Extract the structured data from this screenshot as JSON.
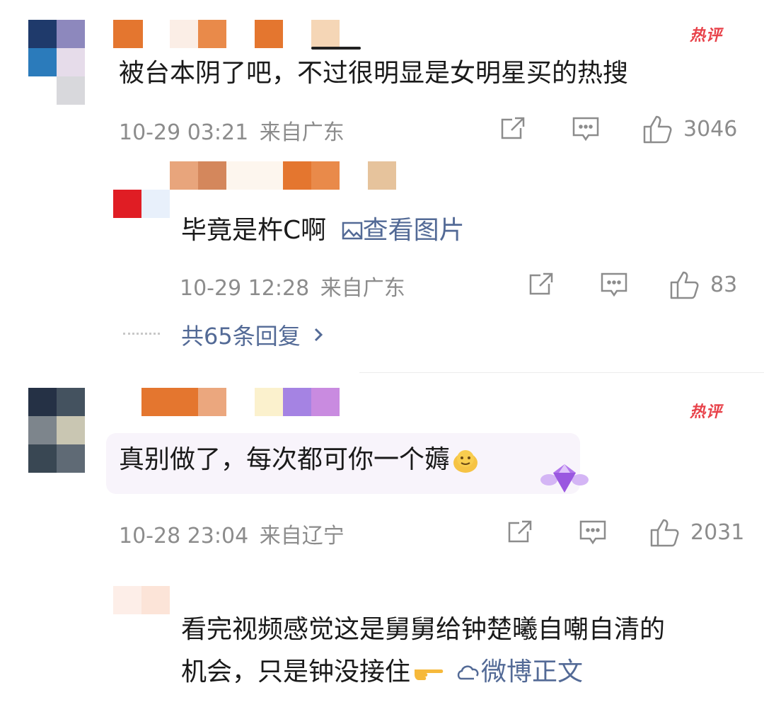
{
  "comments": [
    {
      "hot_badge": "热评",
      "text": "被台本阴了吧，不过很明显是女明星买的热搜",
      "time": "10-29 03:21",
      "location": "来自广东",
      "likes": "3046",
      "reply": {
        "text": "毕竟是杵C啊",
        "image_link": "查看图片",
        "time": "10-29 12:28",
        "location": "来自广东",
        "likes": "83"
      },
      "more_replies": "共65条回复"
    },
    {
      "hot_badge": "热评",
      "text": "真别做了，每次都可你一个薅",
      "time": "10-28 23:04",
      "location": "来自辽宁",
      "likes": "2031"
    },
    {
      "text_line1": "看完视频感觉这是舅舅给钟楚曦自嘲自清的",
      "text_line2": "机会，只是钟没接住",
      "source_link": "微博正文"
    }
  ],
  "colors": {
    "link": "#536a96",
    "hot": "#e8424a",
    "meta": "#8c8c8c"
  }
}
